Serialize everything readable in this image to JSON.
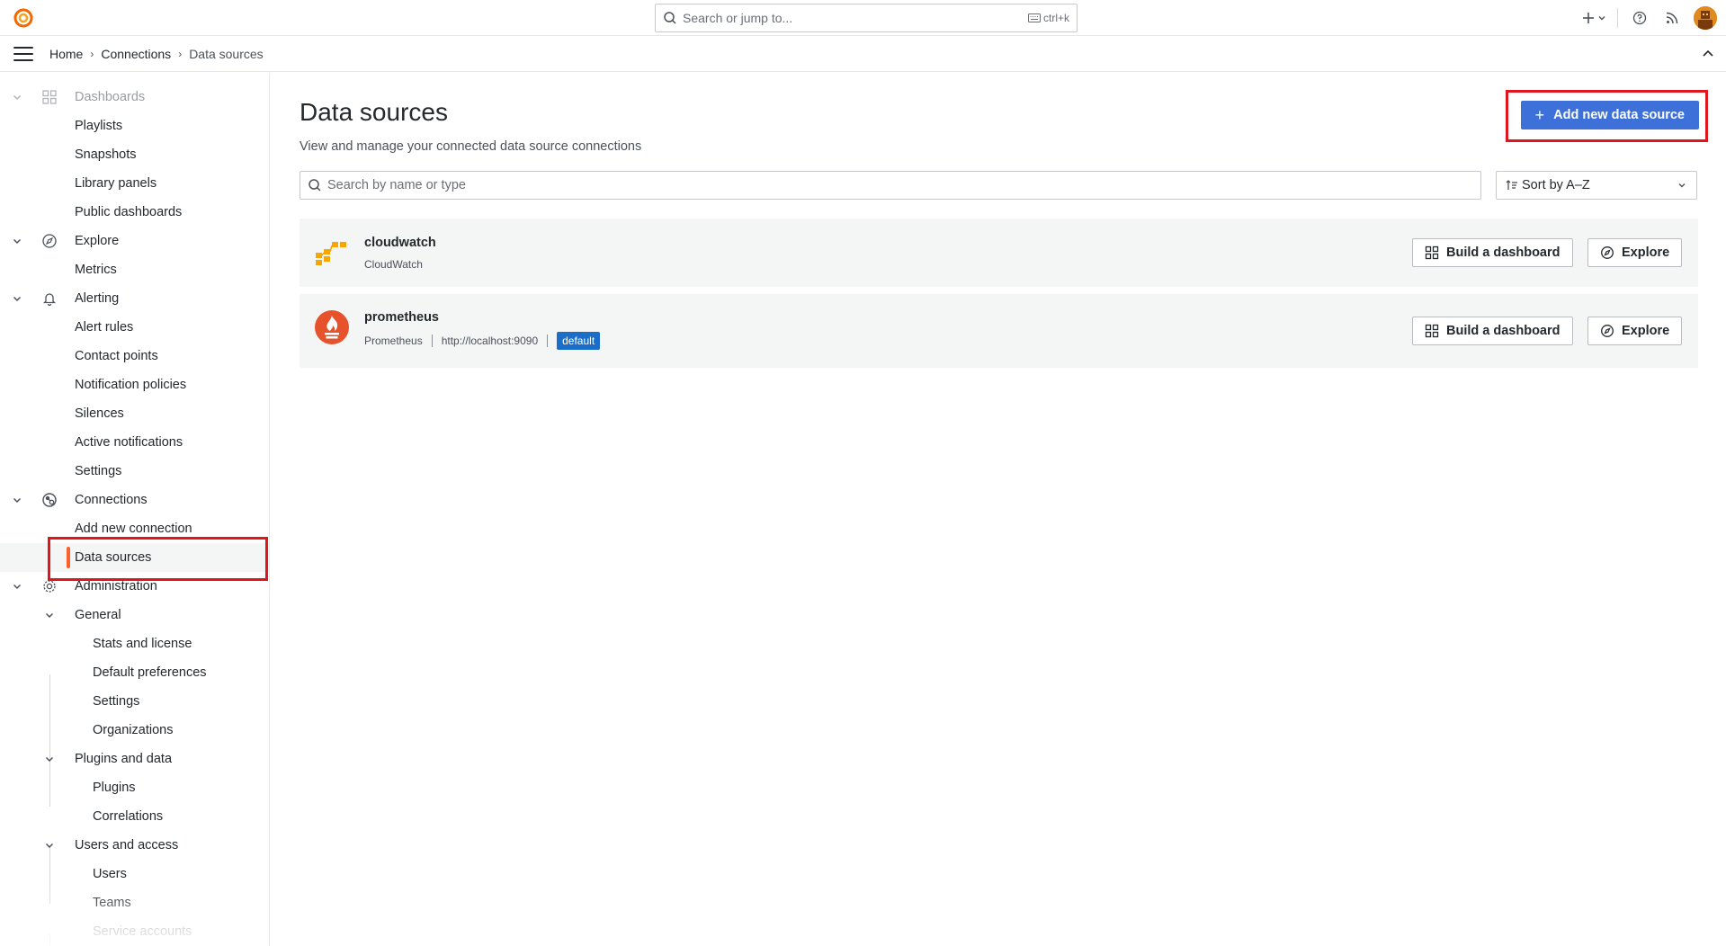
{
  "topbar": {
    "search_placeholder": "Search or jump to...",
    "search_shortcut": "ctrl+k",
    "icons": [
      "grafana-logo-icon",
      "plus-icon",
      "chevron-down-icon",
      "help-icon",
      "rss-icon",
      "avatar"
    ]
  },
  "breadcrumb": {
    "items": [
      "Home",
      "Connections",
      "Data sources"
    ]
  },
  "sidebar": {
    "items": [
      {
        "label": "Dashboards",
        "level": 0,
        "icon": "apps-icon",
        "expanded": true
      },
      {
        "label": "Playlists",
        "level": 1
      },
      {
        "label": "Snapshots",
        "level": 1
      },
      {
        "label": "Library panels",
        "level": 1
      },
      {
        "label": "Public dashboards",
        "level": 1
      },
      {
        "label": "Explore",
        "level": 0,
        "icon": "compass-icon",
        "expanded": true
      },
      {
        "label": "Metrics",
        "level": 1
      },
      {
        "label": "Alerting",
        "level": 0,
        "icon": "bell-icon",
        "expanded": true
      },
      {
        "label": "Alert rules",
        "level": 1
      },
      {
        "label": "Contact points",
        "level": 1
      },
      {
        "label": "Notification policies",
        "level": 1
      },
      {
        "label": "Silences",
        "level": 1
      },
      {
        "label": "Active notifications",
        "level": 1
      },
      {
        "label": "Settings",
        "level": 1
      },
      {
        "label": "Connections",
        "level": 0,
        "icon": "connections-icon",
        "expanded": true
      },
      {
        "label": "Add new connection",
        "level": 1
      },
      {
        "label": "Data sources",
        "level": 1,
        "active": true
      },
      {
        "label": "Administration",
        "level": 0,
        "icon": "cog-icon",
        "expanded": true
      },
      {
        "label": "General",
        "level": 1,
        "expanded": true
      },
      {
        "label": "Stats and license",
        "level": 2
      },
      {
        "label": "Default preferences",
        "level": 2
      },
      {
        "label": "Settings",
        "level": 2
      },
      {
        "label": "Organizations",
        "level": 2
      },
      {
        "label": "Plugins and data",
        "level": 1,
        "expanded": true
      },
      {
        "label": "Plugins",
        "level": 2
      },
      {
        "label": "Correlations",
        "level": 2
      },
      {
        "label": "Users and access",
        "level": 1,
        "expanded": true
      },
      {
        "label": "Users",
        "level": 2
      },
      {
        "label": "Teams",
        "level": 2
      },
      {
        "label": "Service accounts",
        "level": 2
      }
    ]
  },
  "main": {
    "title": "Data sources",
    "subtitle": "View and manage your connected data source connections",
    "add_button": "Add new data source",
    "filter_placeholder": "Search by name or type",
    "sort_label": "Sort by A–Z",
    "datasources": [
      {
        "name": "cloudwatch",
        "type": "CloudWatch",
        "url": "",
        "badge": "",
        "icon": "aws-cloudwatch-icon",
        "build_label": "Build a dashboard",
        "explore_label": "Explore"
      },
      {
        "name": "prometheus",
        "type": "Prometheus",
        "url": "http://localhost:9090",
        "badge": "default",
        "icon": "prometheus-icon",
        "build_label": "Build a dashboard",
        "explore_label": "Explore"
      }
    ]
  },
  "colors": {
    "primary": "#3d71d9",
    "active_accent": "#ff5f2b",
    "highlight": "#e0161e",
    "badge": "#1a6ec7",
    "card_bg": "#f4f5f5"
  }
}
